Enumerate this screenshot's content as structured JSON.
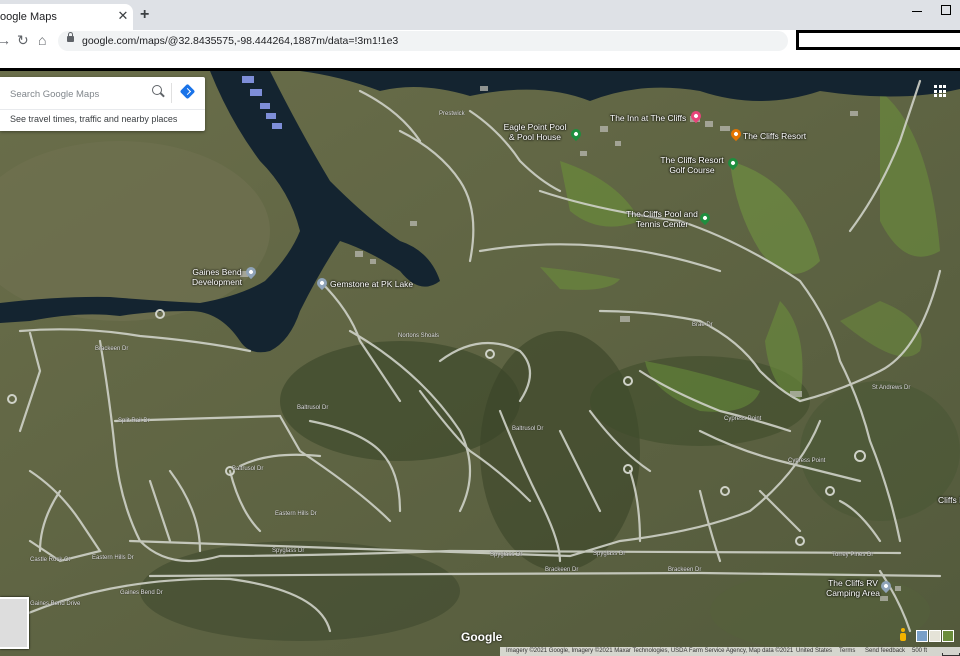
{
  "browser": {
    "tab_title": "oogle Maps",
    "url": "google.com/maps/@32.8435575,-98.444264,1887m/data=!3m1!1e3"
  },
  "search": {
    "placeholder": "Search Google Maps",
    "travel_hint": "See travel times, traffic and nearby places"
  },
  "places": {
    "inn": "The Inn at The Cliffs",
    "resort": "The Cliffs Resort",
    "eagle_point": "Eagle Point Pool & Pool House",
    "golf": "The Cliffs Resort Golf Course",
    "tennis": "The Cliffs Pool and Tennis Center",
    "gaines_bend": "Gaines Bend Development",
    "gemstone": "Gemstone at PK Lake",
    "rv": "The Cliffs RV Camping Area",
    "cliffs_edge": "Cliffs E"
  },
  "streets": {
    "gaines_bend_dr": "Gaines Bend Dr",
    "gaines_bend_dr2": "Gaines Bend Drive",
    "split_rail": "Split Rail Dr",
    "brackeen": "Brackeen Dr",
    "brackeen2": "Brackeen Dr",
    "brackeen3": "Brackeen Dr",
    "baltrusol": "Baltrusol Dr",
    "baltrusol2": "Baltrusol Dr",
    "baltrusol3": "Baltrusol Dr",
    "spyglass": "Spyglass Dr",
    "spyglass2": "Spyglass Dr",
    "spyglass3": "Spyglass Dr",
    "castle_rock": "Castle Rock Ct",
    "eastern_hills": "Eastern Hills Dr",
    "eastern_hills2": "Eastern Hills Dr",
    "cypress_point": "Cypress Point",
    "cypress_point2": "Cypress Point",
    "torrey_pines": "Torrey Pines Dr",
    "st_andrews": "St Andrews Dr",
    "brae_dr": "Brae Dr",
    "nortons_shoals": "Nortons Shoals",
    "prestwick": "Prestwick"
  },
  "footer": {
    "google": "Google",
    "imagery": "Imagery ©2021 Google, Imagery ©2021 Maxar Technologies, USDA Farm Service Agency, Map data ©2021",
    "united_states": "United States",
    "terms": "Terms",
    "feedback": "Send feedback",
    "scale": "500 ft"
  },
  "colors": {
    "water": "#142430",
    "terrain": "#5d6442",
    "road": "#cfd2c8",
    "pin_green": "#1e8e3e",
    "pin_orange": "#e37400",
    "pin_pink": "#e8437a",
    "pin_gray": "#8fa3b8"
  }
}
